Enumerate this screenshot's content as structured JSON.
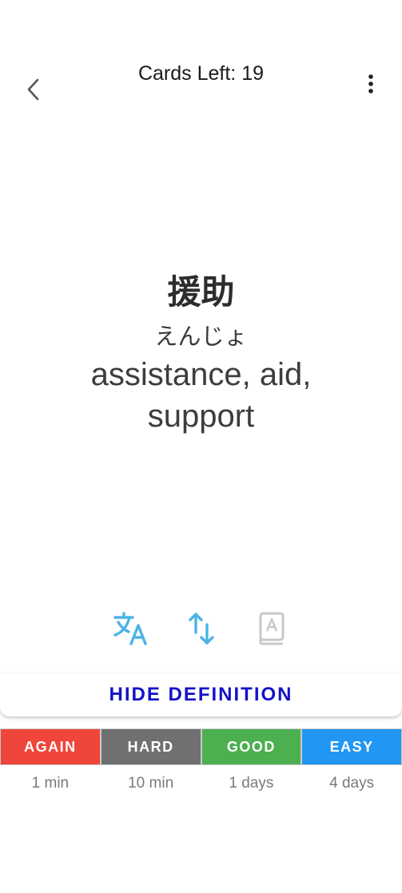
{
  "header": {
    "cards_left_label": "Cards Left:",
    "cards_left_count": "19"
  },
  "card": {
    "term": "援助",
    "reading": "えんじょ",
    "meaning": "assistance, aid, support"
  },
  "tools": [
    {
      "icon": "translate-icon",
      "color": "#4db3e6"
    },
    {
      "icon": "swap-vertical-icon",
      "color": "#4db3e6"
    },
    {
      "icon": "dictionary-book-icon",
      "color": "#c8c8c8"
    }
  ],
  "hide_definition_label": "HIDE DEFINITION",
  "grades": [
    {
      "label": "AGAIN",
      "interval": "1 min",
      "color": "#f0453a"
    },
    {
      "label": "HARD",
      "interval": "10 min",
      "color": "#707070"
    },
    {
      "label": "GOOD",
      "interval": "1 days",
      "color": "#4caf50"
    },
    {
      "label": "EASY",
      "interval": "4 days",
      "color": "#2196f3"
    }
  ],
  "colors": {
    "accent_blue": "#1212c8",
    "icon_blue": "#4db3e6"
  }
}
